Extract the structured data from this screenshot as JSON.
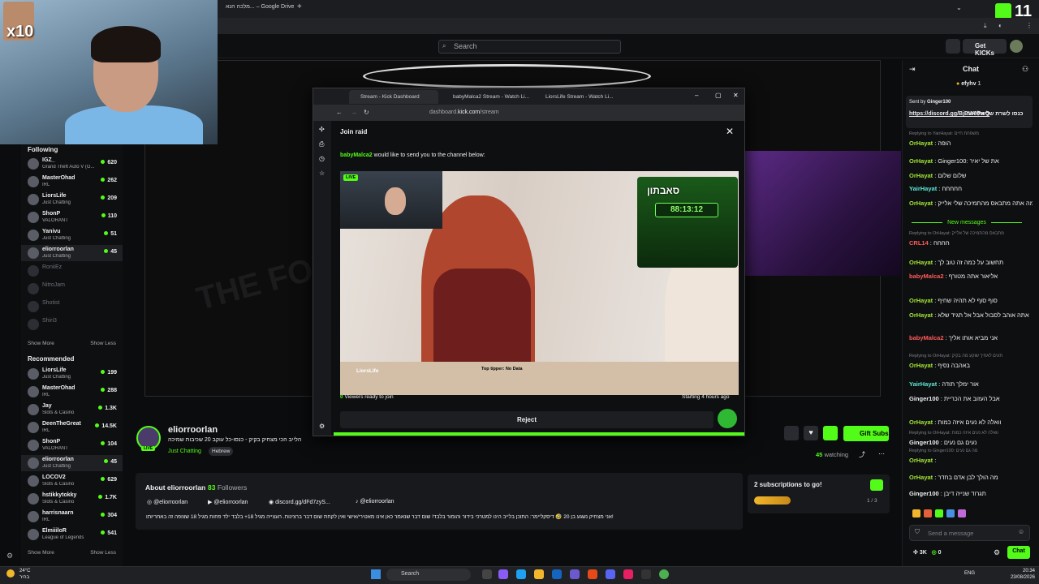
{
  "browser": {
    "tab_title": "מלכה הנא... – Google Drive",
    "overlay_badge": "11"
  },
  "kick_header": {
    "search_placeholder": "Search",
    "get_kicks": "Get KICKs"
  },
  "webcam_overlay": {
    "multiplier": "x10"
  },
  "sidebar": {
    "following_title": "Following",
    "following": [
      {
        "name": "IGZ_",
        "category": "Grand Theft Auto V (G...",
        "viewers": "620",
        "live": true
      },
      {
        "name": "MasterOhad",
        "category": "IRL",
        "viewers": "262",
        "live": true
      },
      {
        "name": "LiorsLife",
        "category": "Just Chatting",
        "viewers": "209",
        "live": true
      },
      {
        "name": "ShonP",
        "category": "VALORANT",
        "viewers": "110",
        "live": true
      },
      {
        "name": "Yanivu",
        "category": "Just Chatting",
        "viewers": "51",
        "live": true
      },
      {
        "name": "eliorroorlan",
        "category": "Just Chatting",
        "viewers": "45",
        "live": true,
        "active": true
      },
      {
        "name": "RoniiEz",
        "category": "",
        "viewers": "",
        "live": false
      },
      {
        "name": "NitroJam",
        "category": "",
        "viewers": "",
        "live": false
      },
      {
        "name": "Shotist",
        "category": "",
        "viewers": "",
        "live": false
      },
      {
        "name": "Shiri3",
        "category": "",
        "viewers": "",
        "live": false
      }
    ],
    "show_more": "Show More",
    "show_less": "Show Less",
    "recommended_title": "Recommended",
    "recommended": [
      {
        "name": "LiorsLife",
        "category": "Just Chatting",
        "viewers": "199"
      },
      {
        "name": "MasterOhad",
        "category": "IRL",
        "viewers": "288"
      },
      {
        "name": "Jay",
        "category": "Slots & Casino",
        "viewers": "1.3K"
      },
      {
        "name": "DeenTheGreat",
        "category": "IRL",
        "viewers": "14.5K"
      },
      {
        "name": "ShonP",
        "category": "VALORANT",
        "viewers": "104"
      },
      {
        "name": "eliorroorlan",
        "category": "Just Chatting",
        "viewers": "45",
        "active": true
      },
      {
        "name": "LOCOV2",
        "category": "Slots & Casino",
        "viewers": "629"
      },
      {
        "name": "hstikkytokky",
        "category": "Slots & Casino",
        "viewers": "1.7K"
      },
      {
        "name": "harrisnaarn",
        "category": "IRL",
        "viewers": "304"
      },
      {
        "name": "ElmiiiloR",
        "category": "League of Legends",
        "viewers": "541"
      }
    ]
  },
  "channel": {
    "name": "eliorroorlan",
    "live_badge": "LIVE",
    "title": "הלייב הכי מצחיק בקיק - כנסו-כל עוקב 20 שכיבות שמיכה",
    "category": "Just Chatting",
    "tag": "Hebrew",
    "gift_subs": "Gift Subs",
    "watching_count": "45",
    "watching_label": "watching"
  },
  "about": {
    "title": "About eliorroorlan",
    "followers_count": "83",
    "followers_label": "Followers",
    "socials": [
      "@eliorroorlan",
      "@eliorroorlan",
      "discord.gg/dFd7zyS...",
      "@eliorroorlan"
    ],
    "description": "אני מצחיק נשגע בן 20 🤣 דיסקליימר: התוכן בלייב הינו למטרכי בידור והומור בלבד! שום דבר שנאמר כאן אינו מאטירי/אישי ואין לקחת שום דבר ברצינות. העצייה מגיל 18+ בלבד ילד פחות מגיל 18 שצופה זה באחריותו!"
  },
  "subs_goal": {
    "title": "2 subscriptions to go!",
    "progress": "1 / 3",
    "progress_fraction": 0.33
  },
  "raid_window": {
    "tabs": [
      "Stream - Kick Dashboard",
      "babyMalca2 Stream - Watch Li...",
      "LiorsLife Stream - Watch Li..."
    ],
    "url_host": "dashboard.",
    "url_domain": "kick.com",
    "url_path": "/stream",
    "title": "Join raid",
    "raider": "babyMalca2",
    "message": "would like to send you to the channel below:",
    "live_badge": "LIVE",
    "overlay_logo": "סאבתון",
    "timer": "88:13:12",
    "streamer": "LiorsLife",
    "tipper": "Top tipper: No Data",
    "viewers_count": "0",
    "viewers_label": "Viewers ready to join",
    "started": "Starting 4 hours ago",
    "reject": "Reject"
  },
  "chat": {
    "title": "Chat",
    "top_user": "efyhv",
    "top_count": "1",
    "pinned_sender": "Sent by",
    "pinned_user": "Ginger100",
    "pinned_link": "https://discord.gg/BjBW8PwQ",
    "pinned_text": "כנסו לשרת של אליאור",
    "new_messages": "New messages",
    "messages": [
      {
        "reply": "Replying to YairHayat: משפחת חיים",
        "user": "OrHayat",
        "color": "#a3e635",
        "text": "הופה"
      },
      {
        "reply": "",
        "user": "OrHayat",
        "color": "#a3e635",
        "text": "Ginger100: את של יאיר"
      },
      {
        "reply": "",
        "user": "OrHayat",
        "color": "#a3e635",
        "text": "שלום שלום"
      },
      {
        "reply": "",
        "user": "YairHayat",
        "color": "#5eead4",
        "text": "חחחחח"
      },
      {
        "reply": "",
        "user": "OrHayat",
        "color": "#a3e635",
        "text": "למה אתה מתבאס מהתמיכה שלי אלייק"
      },
      {
        "reply": "Replying to OrHayat: מתבאס מהתמיכה של אלייק",
        "user": "CRL14",
        "color": "#ff5a5a",
        "text": "חחחח"
      },
      {
        "reply": "",
        "user": "OrHayat",
        "color": "#a3e635",
        "text": "תחשוב על כמה זה טוב לך"
      },
      {
        "reply": "",
        "user": "babyMalca2",
        "color": "#ff5a5a",
        "text": "אליאור אתה מטורף"
      },
      {
        "reply": "",
        "user": "OrHayat",
        "color": "#a3e635",
        "text": "סוף סוף לא תהיה שחיף"
      },
      {
        "reply": "",
        "user": "OrHayat",
        "color": "#a3e635",
        "text": "אתה אוהב לסבול אבל אל תגיד שלא"
      },
      {
        "reply": "",
        "user": "babyMalca2",
        "color": "#ff5a5a",
        "text": "אני מביא אותו אליך"
      },
      {
        "reply": "Replying to OrHayat: תעים לאחיך שוקע מה בקיק",
        "user": "OrHayat",
        "color": "#a3e635",
        "text": "באהבה נסיף"
      },
      {
        "reply": "",
        "user": "YairHayat",
        "color": "#5eead4",
        "text": "אור ימלך תודה"
      },
      {
        "reply": "",
        "user": "Ginger100",
        "color": "#efeff1",
        "text": "אבל העזוב את הכריית"
      },
      {
        "reply": "",
        "user": "OrHayat",
        "color": "#a3e635",
        "text": "וואלה לא נעים איזה כמות"
      },
      {
        "reply": "Replying to OrHayat: וואלה לא נעים איזה כמות",
        "user": "Ginger100",
        "color": "#efeff1",
        "text": "נעים גם נעים"
      },
      {
        "reply": "Replying to Ginger100: מה גם נעים",
        "user": "OrHayat",
        "color": "#a3e635",
        "text": ""
      },
      {
        "reply": "",
        "user": "OrHayat",
        "color": "#a3e635",
        "text": "מה הולך לבן אדם בחדר"
      },
      {
        "reply": "",
        "user": "Ginger100",
        "color": "#efeff1",
        "text": "תגרוד שנייה דיבן"
      }
    ],
    "send_placeholder": "Send a message",
    "kicks_count": "3K",
    "points": "0",
    "chat_button": "Chat"
  },
  "taskbar": {
    "weather_temp": "24°C",
    "weather_desc": "בהיר",
    "search": "Search",
    "lang": "ENG",
    "time": "20:34",
    "date": "23/08/2026"
  }
}
